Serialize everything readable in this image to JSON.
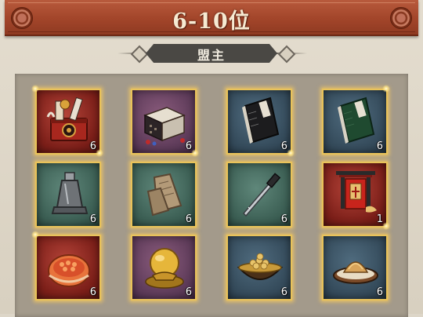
{
  "header": {
    "title": "6-10位"
  },
  "section": {
    "title": "盟主"
  },
  "rewards": [
    {
      "name": "decorated-chest",
      "icon": "decorated-chest-icon",
      "qty": "6",
      "bg": "red"
    },
    {
      "name": "treasure-box",
      "icon": "treasure-box-icon",
      "qty": "6",
      "bg": "purple"
    },
    {
      "name": "black-book",
      "icon": "black-book-icon",
      "qty": "6",
      "bg": "blue"
    },
    {
      "name": "green-book",
      "icon": "green-book-icon",
      "qty": "6",
      "bg": "blue"
    },
    {
      "name": "bell",
      "icon": "bell-icon",
      "qty": "6",
      "bg": "green"
    },
    {
      "name": "stone-tablet",
      "icon": "stone-tablet-icon",
      "qty": "6",
      "bg": "green"
    },
    {
      "name": "dagger",
      "icon": "dagger-icon",
      "qty": "6",
      "bg": "green"
    },
    {
      "name": "banner-shrine",
      "icon": "banner-shrine-icon",
      "qty": "1",
      "bg": "red"
    },
    {
      "name": "food-roll",
      "icon": "food-roll-icon",
      "qty": "6",
      "bg": "red"
    },
    {
      "name": "golden-orb",
      "icon": "golden-orb-icon",
      "qty": "6",
      "bg": "purple"
    },
    {
      "name": "bowl-of-beans",
      "icon": "bowl-of-beans-icon",
      "qty": "6",
      "bg": "blue"
    },
    {
      "name": "dumpling-plate",
      "icon": "dumpling-plate-icon",
      "qty": "6",
      "bg": "blue"
    }
  ]
}
